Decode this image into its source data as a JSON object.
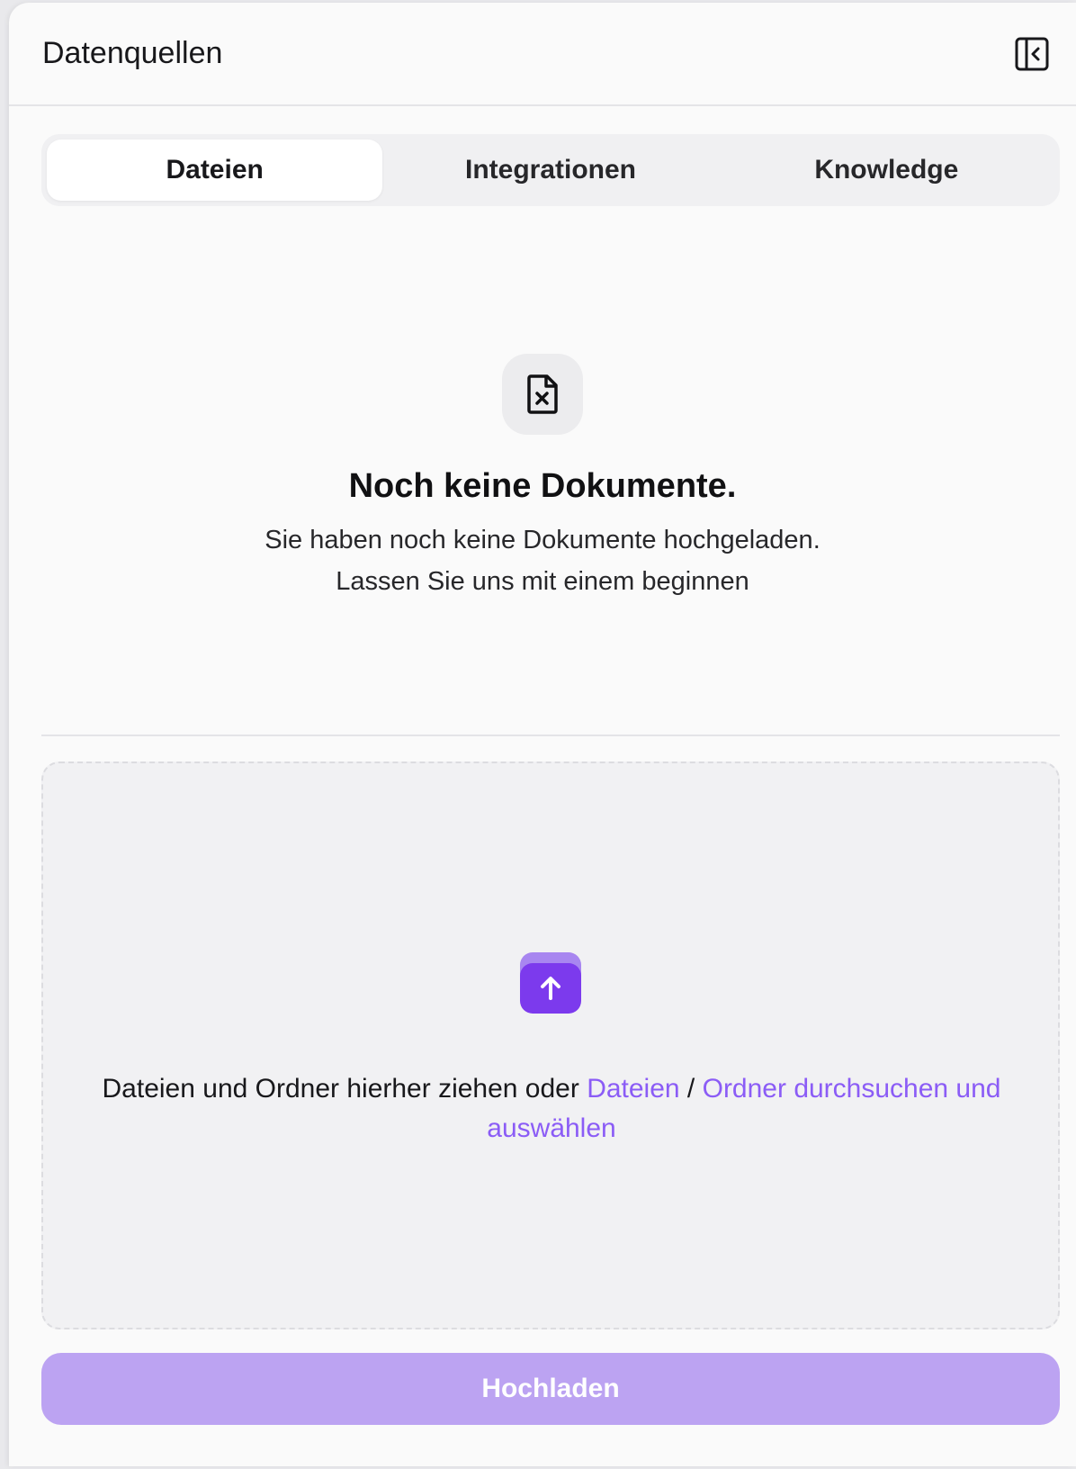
{
  "header": {
    "title": "Datenquellen",
    "collapse_icon": "sidebar-collapse-icon"
  },
  "tabs": [
    {
      "label": "Dateien",
      "active": true
    },
    {
      "label": "Integrationen",
      "active": false
    },
    {
      "label": "Knowledge",
      "active": false
    }
  ],
  "empty_state": {
    "icon": "file-x-icon",
    "title": "Noch keine Dokumente.",
    "line1": "Sie haben noch keine Dokumente hochgeladen.",
    "line2": "Lassen Sie uns mit einem beginnen"
  },
  "dropzone": {
    "icon": "upload-icon",
    "text_prefix": "Dateien und Ordner hierher ziehen oder ",
    "link_files": "Dateien",
    "separator": " / ",
    "link_folder": "Ordner durchsuchen und auswählen"
  },
  "upload_button": {
    "label": "Hochladen"
  },
  "colors": {
    "accent": "#7c3aed",
    "link": "#8b5cf6",
    "button_disabled": "#bca3f2"
  }
}
